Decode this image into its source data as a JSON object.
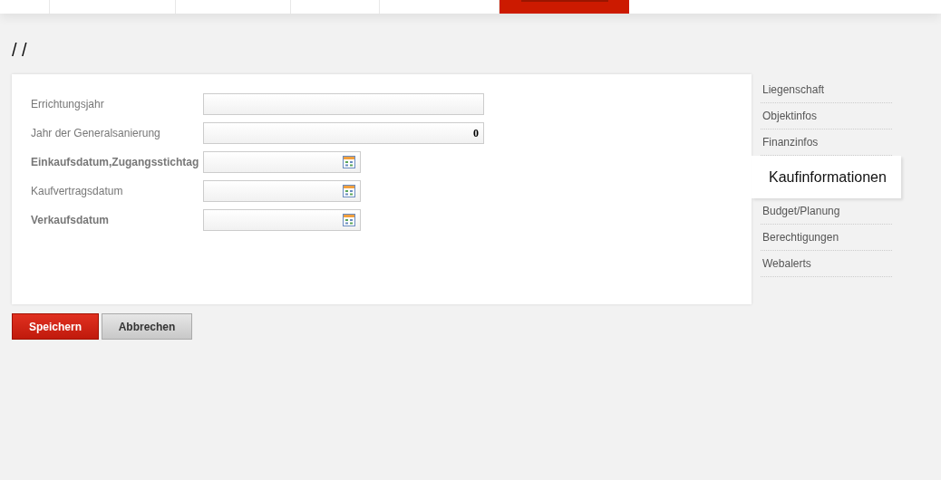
{
  "nav_tabs": [
    {
      "selected": false
    },
    {
      "selected": false
    },
    {
      "selected": false
    },
    {
      "selected": false
    },
    {
      "selected": false
    },
    {
      "selected": true
    }
  ],
  "page_title": "/ /",
  "fields": [
    {
      "label": "Errichtungsjahr",
      "bold": false,
      "kind": "text"
    },
    {
      "label": "Jahr der Generalsanierung",
      "bold": false,
      "kind": "text",
      "value": "0"
    },
    {
      "label": "Einkaufsdatum,Zugangsstichtag",
      "bold": true,
      "kind": "date"
    },
    {
      "label": "Kaufvertragsdatum",
      "bold": false,
      "kind": "date"
    },
    {
      "label": "Verkaufsdatum",
      "bold": true,
      "kind": "date"
    }
  ],
  "sidebar": {
    "items": [
      {
        "label": "Liegenschaft",
        "selected": false
      },
      {
        "label": "Objektinfos",
        "selected": false
      },
      {
        "label": "Finanzinfos",
        "selected": false
      },
      {
        "label": "Kaufinformationen",
        "selected": true
      },
      {
        "label": "Budget/Planung",
        "selected": false
      },
      {
        "label": "Berechtigungen",
        "selected": false
      },
      {
        "label": "Webalerts",
        "selected": false
      }
    ]
  },
  "buttons": [
    {
      "label": "Speichern",
      "kind": "primary"
    },
    {
      "label": "Abbrechen",
      "kind": "secondary"
    }
  ]
}
